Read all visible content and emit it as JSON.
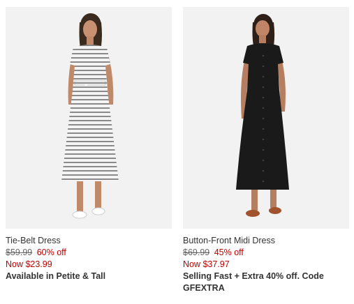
{
  "products": [
    {
      "name": "Tie-Belt Dress",
      "original_price": "$59.99",
      "discount": "60% off",
      "now_price": "Now $23.99",
      "badge": "Available in Petite & Tall",
      "image_icon": "model-striped-dress-photo"
    },
    {
      "name": "Button-Front Midi Dress",
      "original_price": "$69.99",
      "discount": "45% off",
      "now_price": "Now $37.97",
      "badge": "Selling Fast + Extra 40% off. Code GFEXTRA",
      "image_icon": "model-black-dress-photo"
    }
  ],
  "colors": {
    "sale_red": "#c00000",
    "text": "#333333",
    "image_bg": "#f2f2f2"
  }
}
